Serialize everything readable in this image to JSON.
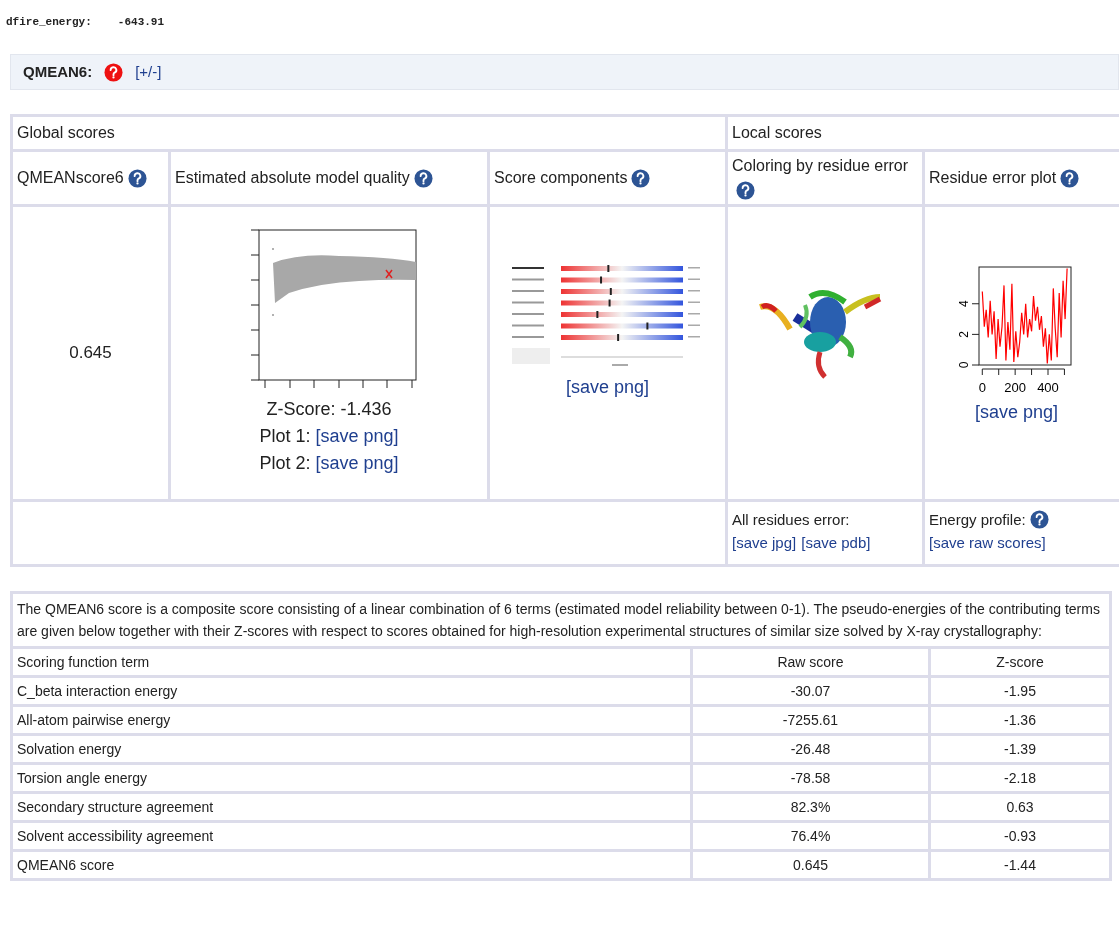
{
  "dfire": {
    "label": "dfire_energy:",
    "value": "-643.91"
  },
  "section": {
    "title": "QMEAN6:",
    "toggle": "[+/-]"
  },
  "scores_table": {
    "group_headers": [
      "Global scores",
      "Local scores"
    ],
    "columns": [
      "QMEANscore6",
      "Estimated absolute model quality",
      "Score components",
      "Coloring by residue error",
      "Residue error plot"
    ],
    "qmean_score": "0.645",
    "quality": {
      "zscore": "Z-Score: -1.436",
      "plot1_label": "Plot 1:",
      "plot1_link": "[save png]",
      "plot2_label": "Plot 2:",
      "plot2_link": "[save png]"
    },
    "components_link": "[save png]",
    "coloring": {
      "kind": "picture"
    },
    "residue_plot": {
      "link": "[save png]",
      "chart_data": {
        "type": "line",
        "x": [
          0,
          12,
          24,
          36,
          48,
          60,
          72,
          84,
          96,
          108,
          120,
          132,
          144,
          156,
          168,
          180,
          192,
          204,
          216,
          228,
          240,
          252,
          264,
          276,
          288,
          300,
          312,
          324,
          336,
          348,
          360,
          372,
          384,
          396,
          408,
          420,
          432,
          444,
          456,
          468,
          480,
          492,
          504,
          516
        ],
        "series": [
          {
            "color": "#ff0000",
            "values": [
              4.8,
              2.5,
              3.6,
              1.8,
              4.2,
              2.0,
              3.5,
              0.4,
              3.0,
              1.2,
              2.5,
              5.2,
              0.3,
              2.8,
              1.0,
              5.3,
              0.2,
              2.2,
              0.5,
              1.5,
              3.4,
              2.0,
              4.0,
              1.8,
              3.0,
              2.2,
              4.5,
              2.9,
              3.8,
              2.3,
              3.2,
              1.2,
              2.4,
              0.1,
              2.0,
              0.3,
              5.0,
              2.4,
              0.5,
              4.7,
              1.8,
              5.5,
              3.0,
              6.3
            ]
          }
        ],
        "xlim": [
          -20,
          540
        ],
        "ylim": [
          0,
          6.4
        ],
        "xticks": [
          0,
          200,
          400
        ],
        "yticks": [
          0,
          2,
          4
        ]
      }
    },
    "footer": {
      "residues_label": "All residues error:",
      "save_jpg": "[save jpg]",
      "save_pdb": "[save pdb]",
      "energy_label": "Energy profile:",
      "save_raw": "[save raw scores]"
    }
  },
  "terms_table": {
    "description": "The QMEAN6 score is a composite score consisting of a linear combination of 6 terms (estimated model reliability between 0-1). The pseudo-energies of the contributing terms are given below together with their Z-scores with respect to scores obtained for high-resolution experimental structures of similar size solved by X-ray crystallography:",
    "columns": [
      "Scoring function term",
      "Raw score",
      "Z-score"
    ],
    "rows": [
      [
        "C_beta interaction energy",
        "-30.07",
        "-1.95"
      ],
      [
        "All-atom pairwise energy",
        "-7255.61",
        "-1.36"
      ],
      [
        "Solvation energy",
        "-26.48",
        "-1.39"
      ],
      [
        "Torsion angle energy",
        "-78.58",
        "-2.18"
      ],
      [
        "Secondary structure agreement",
        "82.3%",
        "0.63"
      ],
      [
        "Solvent accessibility agreement",
        "76.4%",
        "-0.93"
      ],
      [
        "QMEAN6 score",
        "0.645",
        "-1.44"
      ]
    ]
  }
}
